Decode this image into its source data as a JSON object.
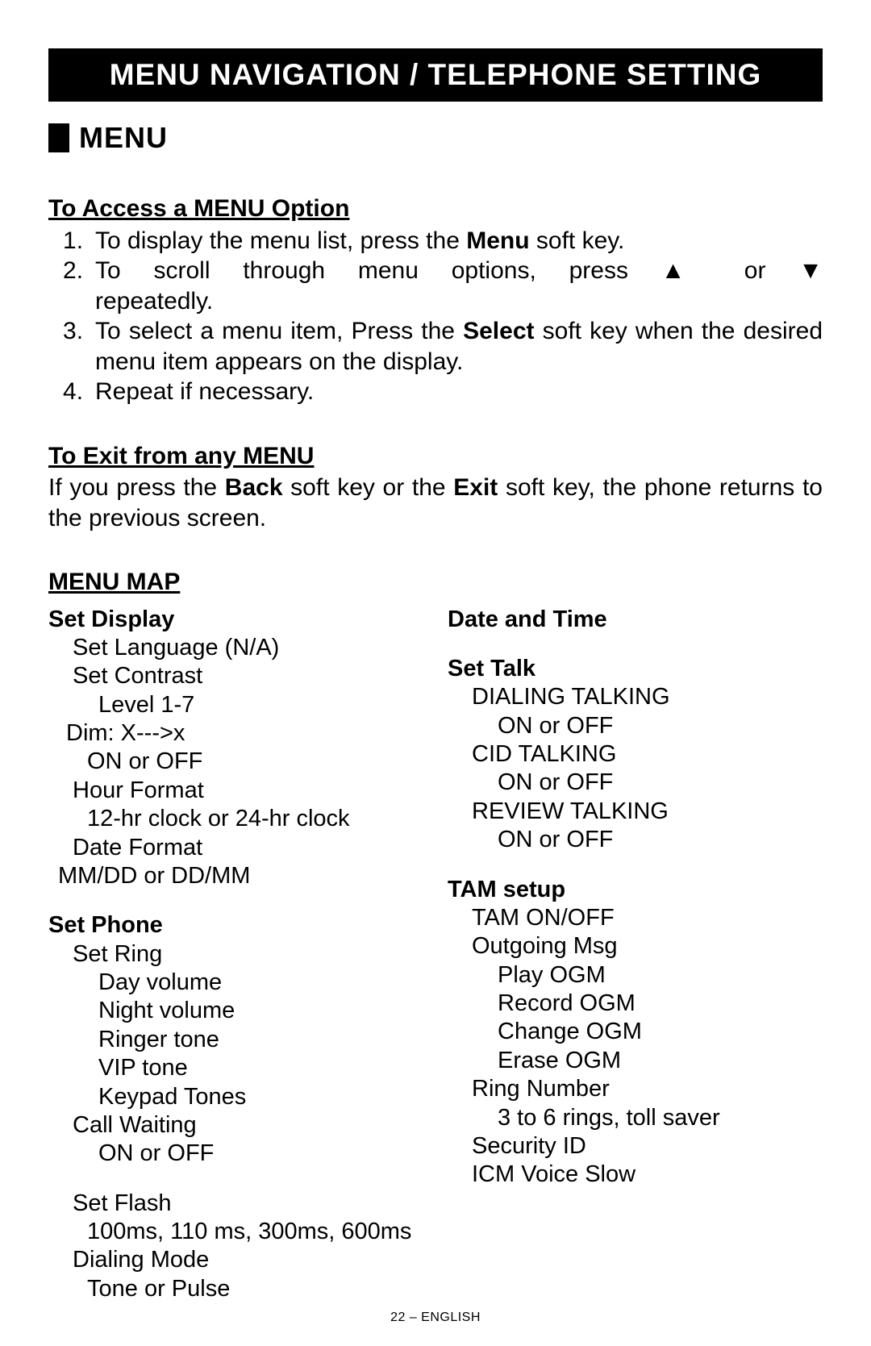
{
  "banner": "MENU NAVIGATION / TELEPHONE SETTING",
  "section": "MENU",
  "access": {
    "title": "To Access a MENU Option",
    "s1a": "To display the menu list, press the ",
    "s1b": "Menu",
    "s1c": " soft key.",
    "s2a": "To scroll through menu options, press ",
    "s2up": "▲",
    "s2or": " or ",
    "s2dn": "▼",
    "s2b": "repeatedly.",
    "s3a": "To select a menu item, Press the ",
    "s3b": "Select",
    "s3c": " soft key when the desired menu item appears on the display.",
    "s4": "Repeat if necessary."
  },
  "exit": {
    "title": "To Exit from any MENU",
    "p1": "If you press the ",
    "pb1": "Back",
    "p2": " soft key or the ",
    "pb2": "Exit",
    "p3": " soft key, the phone returns to the previous screen."
  },
  "map": {
    "title": "MENU MAP",
    "setDisplay": "Set Display",
    "setLanguage": "Set Language (N/A)",
    "setContrast": "Set Contrast",
    "level": "Level 1-7",
    "dim": "Dim: X--->x",
    "onoff": "ON or OFF",
    "hourFormat": "Hour Format",
    "hourOpt": "12-hr clock or 24-hr clock",
    "dateFormat": "Date Format",
    "dateOpt": "MM/DD or DD/MM",
    "setPhone": "Set Phone",
    "setRing": "Set Ring",
    "dayVol": "Day volume",
    "nightVol": "Night volume",
    "ringerTone": "Ringer tone",
    "vipTone": "VIP tone",
    "keypadTones": "Keypad Tones",
    "callWaiting": "Call Waiting",
    "setFlash": "Set Flash",
    "flashOpt": "100ms, 110 ms, 300ms, 600ms",
    "dialMode": "Dialing Mode",
    "dialOpt": "Tone or Pulse",
    "dateTime": "Date and Time",
    "setTalk": "Set Talk",
    "dialTalk": "DIALING TALKING",
    "cidTalk": "CID TALKING",
    "revTalk": "REVIEW TALKING",
    "tam": "TAM setup",
    "tamOnOff": "TAM ON/OFF",
    "outMsg": "Outgoing Msg",
    "playOgm": "Play OGM",
    "recOgm": "Record OGM",
    "chgOgm": "Change OGM",
    "eraseOgm": "Erase OGM",
    "ringNum": "Ring Number",
    "ringOpt": "3 to 6 rings, toll saver",
    "secId": "Security ID",
    "icm": "ICM Voice Slow"
  },
  "footer": "22 – ENGLISH"
}
